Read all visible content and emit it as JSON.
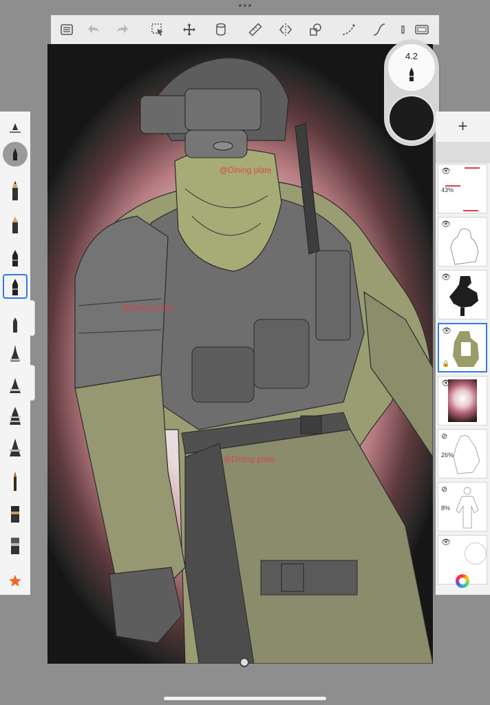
{
  "toolbar": {
    "tools": [
      "menu-icon",
      "undo-icon",
      "redo-icon",
      "selection-icon",
      "transform-icon",
      "fill-bucket-icon",
      "ruler-icon",
      "symmetry-icon",
      "shapes-icon",
      "perspective-icon",
      "curve-icon",
      "partial-tool-icon",
      "fullscreen-icon"
    ]
  },
  "brush_panel": {
    "items": [
      "brush-adjust-icon",
      "brush-size-preview",
      "pencil-icon",
      "marker-icon",
      "pen-icon",
      "ballpoint-icon",
      "fineliner-icon",
      "airbrush-icon",
      "paintbrush-icon",
      "chisel-icon",
      "wide-brush-icon",
      "smudge-icon",
      "flat-brush-icon",
      "eraser-brush-icon",
      "favorites-star-icon"
    ],
    "selected_index": 5
  },
  "brush_size": {
    "value": "4.2",
    "color": "#1c1c1c"
  },
  "layers": {
    "add_label": "+",
    "items": [
      {
        "name": "watermark-layer",
        "opacity": "43%",
        "visible": true
      },
      {
        "name": "lineart-layer",
        "opacity": "",
        "visible": true
      },
      {
        "name": "shadow-layer",
        "opacity": "",
        "visible": true
      },
      {
        "name": "color-layer",
        "opacity": "",
        "visible": true,
        "selected": true
      },
      {
        "name": "background-gradient-layer",
        "opacity": "",
        "visible": true
      },
      {
        "name": "sketch-layer",
        "opacity": "26%",
        "visible": false
      },
      {
        "name": "rough-sketch-layer",
        "opacity": "8%",
        "visible": false
      },
      {
        "name": "paper-layer",
        "opacity": "",
        "visible": true
      }
    ]
  },
  "watermark": "@Dining plate",
  "colors": {
    "accent": "#2f7be6",
    "background": "#8e8e8e",
    "watermark": "#e4394a"
  }
}
